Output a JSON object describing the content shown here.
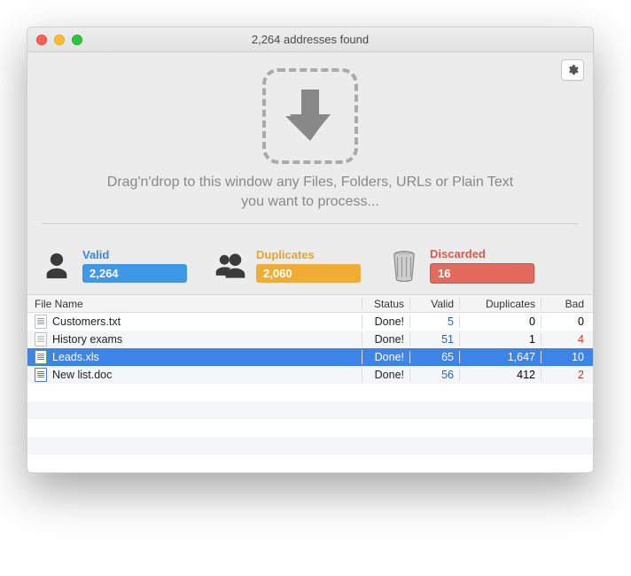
{
  "window": {
    "title": "2,264 addresses found"
  },
  "drop": {
    "hint": "Drag'n'drop to this window any Files, Folders, URLs or Plain Text you want to process..."
  },
  "stats": {
    "valid": {
      "label": "Valid",
      "count": "2,264"
    },
    "duplicates": {
      "label": "Duplicates",
      "count": "2,060"
    },
    "discarded": {
      "label": "Discarded",
      "count": "16"
    }
  },
  "table": {
    "columns": {
      "name": "File Name",
      "status": "Status",
      "valid": "Valid",
      "duplicates": "Duplicates",
      "bad": "Bad"
    },
    "rows": [
      {
        "icon": "txt",
        "name": "Customers.txt",
        "status": "Done!",
        "valid": "5",
        "dup": "0",
        "bad": "0",
        "selected": false
      },
      {
        "icon": "generic",
        "name": "History exams",
        "status": "Done!",
        "valid": "51",
        "dup": "1",
        "bad": "4",
        "selected": false
      },
      {
        "icon": "xls",
        "name": "Leads.xls",
        "status": "Done!",
        "valid": "65",
        "dup": "1,647",
        "bad": "10",
        "selected": true
      },
      {
        "icon": "doc",
        "name": "New list.doc",
        "status": "Done!",
        "valid": "56",
        "dup": "412",
        "bad": "2",
        "selected": false
      }
    ]
  },
  "colors": {
    "blue": "#3f97e8",
    "orange": "#f0ad35",
    "red": "#e36a5d"
  }
}
